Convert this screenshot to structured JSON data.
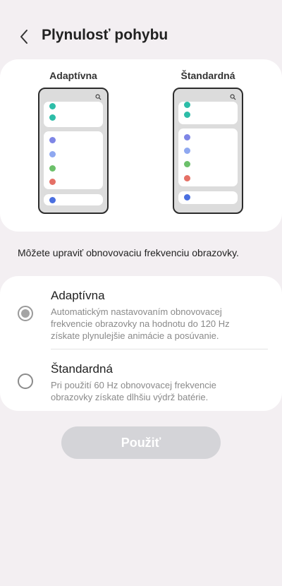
{
  "header": {
    "title": "Plynulosť pohybu",
    "back_icon": "chevron-left-icon"
  },
  "preview": {
    "left_label": "Adaptívna",
    "right_label": "Štandardná",
    "dot_colors": {
      "teal": "#2dbda8",
      "blue": "#7e86e6",
      "lightblue": "#8fa8f0",
      "green": "#6cc06a",
      "red": "#e57066",
      "navy": "#4a6fe0"
    }
  },
  "description": "Môžete upraviť obnovovaciu frekvenciu obrazovky.",
  "options": [
    {
      "title": "Adaptívna",
      "subtitle_lines": [
        "Automatickým nastavovaním obnovovacej",
        "frekvencie obrazovky na hodnotu do 120 Hz",
        "získate plynulejšie animácie a posúvanie."
      ],
      "selected": true
    },
    {
      "title": "Štandardná",
      "subtitle_lines": [
        "Pri použití 60 Hz obnovovacej frekvencie",
        "obrazovky získate dlhšiu výdrž batérie."
      ],
      "selected": false
    }
  ],
  "apply_button": {
    "label": "Použiť",
    "enabled": false
  }
}
